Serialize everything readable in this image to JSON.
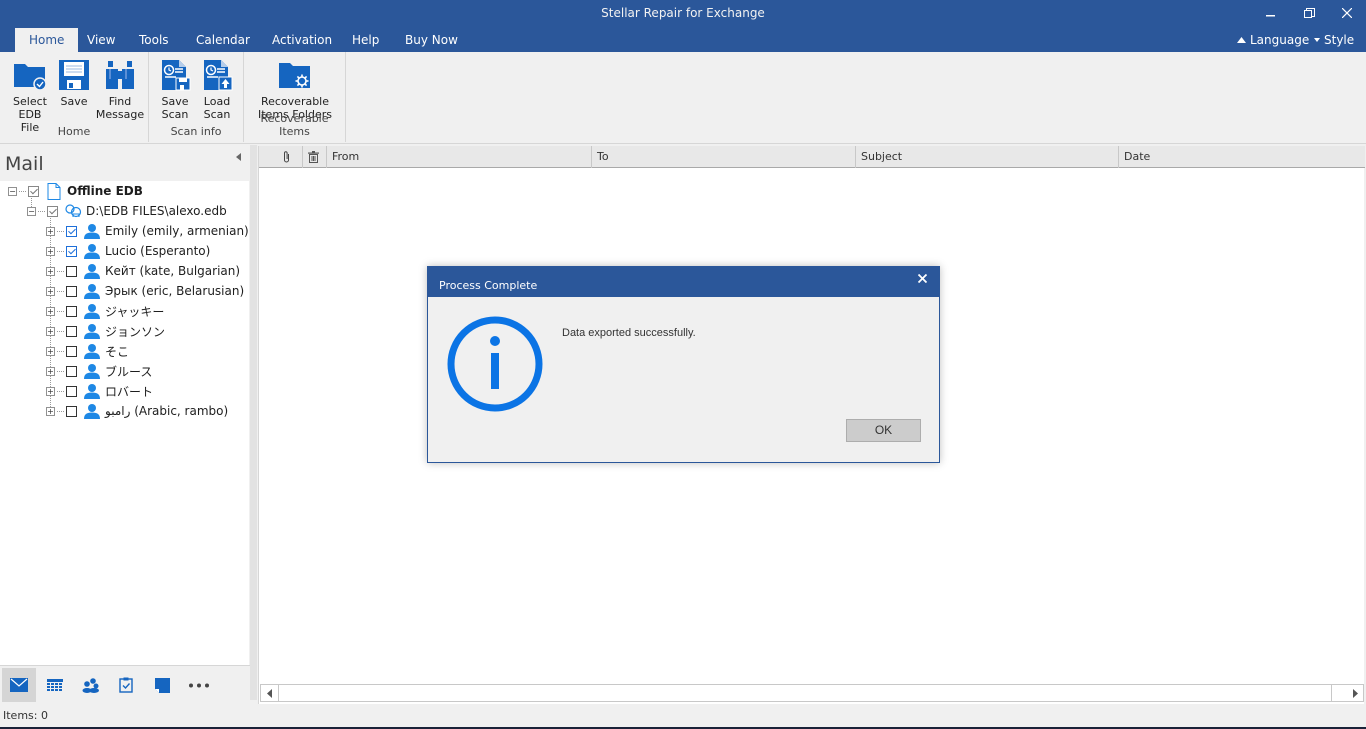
{
  "window": {
    "title": "Stellar Repair for Exchange",
    "controls": {
      "minimize": "minimize-icon",
      "restore": "restore-icon",
      "close": "close-icon"
    }
  },
  "tabs": [
    {
      "label": "Home",
      "active": true
    },
    {
      "label": "View"
    },
    {
      "label": "Tools"
    },
    {
      "label": "Calendar"
    },
    {
      "label": "Activation"
    },
    {
      "label": "Help"
    },
    {
      "label": "Buy Now"
    }
  ],
  "tab_right": {
    "language": "Language",
    "style": "Style"
  },
  "ribbon": {
    "groups": [
      {
        "label": "Home",
        "buttons": [
          {
            "label": "Select\nEDB File",
            "icon": "folder-check-icon"
          },
          {
            "label": "Save",
            "icon": "floppy-disk-icon"
          },
          {
            "label": "Find\nMessage",
            "icon": "binoculars-icon"
          }
        ]
      },
      {
        "label": "Scan info",
        "buttons": [
          {
            "label": "Save\nScan",
            "icon": "save-scan-icon"
          },
          {
            "label": "Load\nScan",
            "icon": "load-scan-icon"
          }
        ]
      },
      {
        "label": "Recoverable Items",
        "buttons": [
          {
            "label": "Recoverable\nItems Folders",
            "icon": "folder-gear-icon"
          }
        ]
      }
    ]
  },
  "left_panel": {
    "title": "Mail",
    "tree": {
      "root": {
        "label": "Offline EDB",
        "checked": "partial"
      },
      "file": {
        "label": "D:\\EDB FILES\\alexo.edb",
        "checked": "partial"
      },
      "mailboxes": [
        {
          "label": "Emily (emily, armenian)",
          "checked": true
        },
        {
          "label": "Lucio (Esperanto)",
          "checked": true
        },
        {
          "label": "Кейт (kate, Bulgarian)",
          "checked": false
        },
        {
          "label": "Эрык (eric, Belarusian)",
          "checked": false
        },
        {
          "label": "ジャッキー",
          "checked": false
        },
        {
          "label": "ジョンソン",
          "checked": false
        },
        {
          "label": "そこ",
          "checked": false
        },
        {
          "label": "ブルース",
          "checked": false
        },
        {
          "label": "ロバート",
          "checked": false
        },
        {
          "label": "رامبو (Arabic, rambo)",
          "checked": false
        }
      ]
    },
    "bottom_nav": [
      "mail-icon",
      "calendar-icon",
      "contacts-icon",
      "tasks-icon",
      "notes-icon",
      "more-icon"
    ]
  },
  "grid": {
    "columns": [
      "",
      "",
      "From",
      "To",
      "Subject",
      "Date"
    ],
    "rows": []
  },
  "status": {
    "items": "Items: 0"
  },
  "dialog": {
    "title": "Process Complete",
    "message": "Data exported successfully.",
    "ok_label": "OK",
    "close": "×"
  },
  "colors": {
    "brand": "#2b579a",
    "icon_blue": "#1565c0",
    "info_blue": "#0b74e5"
  }
}
